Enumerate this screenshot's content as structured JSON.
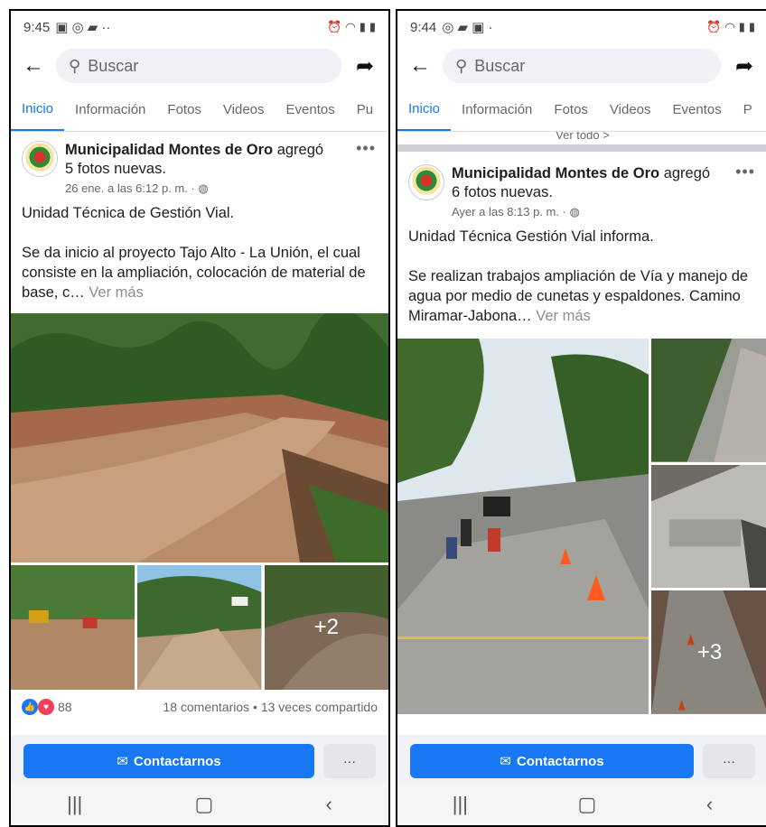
{
  "left": {
    "status": {
      "time": "9:45",
      "icons": "▣ ◎ ▰ ··"
    },
    "search": {
      "placeholder": "Buscar"
    },
    "tabs": [
      "Inicio",
      "Información",
      "Fotos",
      "Videos",
      "Eventos",
      "Pu"
    ],
    "post": {
      "author": "Municipalidad Montes de Oro",
      "action_pre": " agregó",
      "action_line2": "5 fotos nuevas.",
      "time": "26 ene. a las 6:12 p. m. · ◍",
      "text": [
        "Unidad Técnica de Gestión Vial.",
        "Se da inicio al proyecto Tajo Alto - La Unión, el cual consiste  en la ampliación, colocación de material de base, c…"
      ],
      "see_more": "Ver más",
      "extra_photos": "+2"
    },
    "reactions": {
      "count": "88",
      "summary": "18 comentarios • 13 veces compartido"
    },
    "contact_label": "Contactarnos",
    "menu_label": "···"
  },
  "right": {
    "status": {
      "time": "9:44",
      "icons": "◎ ▰ ▣ ·"
    },
    "search": {
      "placeholder": "Buscar"
    },
    "tabs": [
      "Inicio",
      "Información",
      "Fotos",
      "Videos",
      "Eventos",
      "P"
    ],
    "peek_text": "Ver todo >",
    "post": {
      "author": "Municipalidad Montes de Oro",
      "action_pre": " agregó",
      "action_line2": "6 fotos nuevas.",
      "time": "Ayer a las 8:13 p. m. · ◍",
      "text": [
        "Unidad Técnica Gestión Vial informa.",
        "Se realizan trabajos ampliación de Vía y manejo de agua por medio de cunetas y espaldones. Camino Miramar-Jabona…"
      ],
      "see_more": "Ver más",
      "extra_photos": "+3"
    },
    "contact_label": "Contactarnos",
    "menu_label": "···"
  },
  "colors": {
    "brand": "#1877f2",
    "like": "#1877f2",
    "love": "#f33e58"
  },
  "icons": {
    "back": "arrow-left-icon",
    "search": "magnifier-icon",
    "share": "share-arrow-icon",
    "mail": "envelope-icon"
  }
}
